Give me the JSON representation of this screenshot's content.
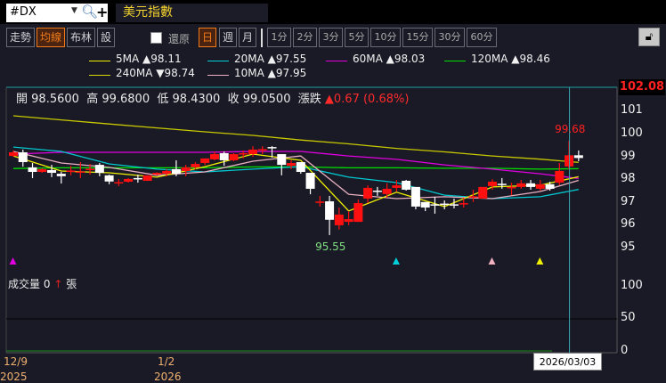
{
  "header": {
    "symbol": "#DX",
    "title": "美元指數"
  },
  "toolbar": {
    "modes": [
      {
        "label": "走勢",
        "active": false
      },
      {
        "label": "均線",
        "active": true
      },
      {
        "label": "布林",
        "active": false
      },
      {
        "label": "設",
        "active": false
      }
    ],
    "restore_label": "還原",
    "restore_checked": false,
    "periods": [
      {
        "label": "日",
        "active": true
      },
      {
        "label": "週",
        "active": false
      },
      {
        "label": "月",
        "active": false
      }
    ],
    "intervals": [
      "1分",
      "2分",
      "3分",
      "5分",
      "10分",
      "15分",
      "30分",
      "60分"
    ]
  },
  "legend": [
    {
      "name": "5MA",
      "dir": "▲",
      "value": "98.11",
      "color": "#f0f000"
    },
    {
      "name": "20MA",
      "dir": "▲",
      "value": "97.55",
      "color": "#00d0d8"
    },
    {
      "name": "60MA",
      "dir": "▲",
      "value": "98.03",
      "color": "#e000e0"
    },
    {
      "name": "120MA",
      "dir": "▲",
      "value": "98.46",
      "color": "#00e000"
    },
    {
      "name": "240MA",
      "dir": "▼",
      "value": "98.74",
      "color": "#d8d800"
    },
    {
      "name": "10MA",
      "dir": "▲",
      "value": "97.95",
      "color": "#f0b0c0"
    }
  ],
  "info": {
    "open_label": "開",
    "open": "98.5600",
    "high_label": "高",
    "high": "99.6800",
    "low_label": "低",
    "low": "98.4300",
    "close_label": "收",
    "close": "99.0500",
    "change_label": "漲跌",
    "change": "▲0.67 (0.68%)"
  },
  "volume": {
    "label": "成交量",
    "value": "0",
    "arrow": "↑",
    "unit": "張"
  },
  "selected_date": "2026/03/03",
  "current_price_label": "102.08",
  "chart_data": {
    "type": "candlestick",
    "price_axis": {
      "ticks": [
        "101",
        "100",
        "99",
        "98",
        "97",
        "96",
        "95"
      ]
    },
    "volume_axis": {
      "ticks": [
        "100",
        "50",
        "0"
      ]
    },
    "x_labels": [
      {
        "date": "12/9",
        "year": "2025",
        "index": 0
      },
      {
        "date": "1/2",
        "year": "2026",
        "index": 15
      }
    ],
    "annotations": [
      {
        "text": "99.68",
        "index": 58,
        "color": "#ff2020",
        "type": "high"
      },
      {
        "text": "95.55",
        "index": 33,
        "color": "#80e080",
        "type": "low"
      }
    ],
    "crosshair_index": 58,
    "up_color": "#ff1010",
    "down_color": "#ffffff",
    "ohlc": [
      [
        99.02,
        99.26,
        98.98,
        99.18
      ],
      [
        99.18,
        99.3,
        98.55,
        98.75
      ],
      [
        98.52,
        98.71,
        98.05,
        98.32
      ],
      [
        98.32,
        98.48,
        98.28,
        98.44
      ],
      [
        98.4,
        98.63,
        98.09,
        98.28
      ],
      [
        98.24,
        98.32,
        97.81,
        98.13
      ],
      [
        98.34,
        98.59,
        98.17,
        98.38
      ],
      [
        98.3,
        98.75,
        98.05,
        98.34
      ],
      [
        98.42,
        98.67,
        98.2,
        98.46
      ],
      [
        98.63,
        98.71,
        98.13,
        98.28
      ],
      [
        98.17,
        98.2,
        97.78,
        97.9
      ],
      [
        97.83,
        98.01,
        97.7,
        97.87
      ],
      [
        97.89,
        98.05,
        97.85,
        98.01
      ],
      [
        98.05,
        98.2,
        97.85,
        98.01
      ],
      [
        97.93,
        98.17,
        97.93,
        98.17
      ],
      [
        98.2,
        98.3,
        98.17,
        98.28
      ],
      [
        98.24,
        98.44,
        98.13,
        98.36
      ],
      [
        98.44,
        98.83,
        98.13,
        98.24
      ],
      [
        98.36,
        98.63,
        98.13,
        98.52
      ],
      [
        98.52,
        98.75,
        98.44,
        98.67
      ],
      [
        98.71,
        98.91,
        98.63,
        98.91
      ],
      [
        98.87,
        99.22,
        98.83,
        99.1
      ],
      [
        99.14,
        99.22,
        98.59,
        98.83
      ],
      [
        98.83,
        99.14,
        98.79,
        99.1
      ],
      [
        99.14,
        99.26,
        98.91,
        99.14
      ],
      [
        99.1,
        99.45,
        98.98,
        99.3
      ],
      [
        99.3,
        99.45,
        99.1,
        99.32
      ],
      [
        99.41,
        99.45,
        98.95,
        99.37
      ],
      [
        99.1,
        99.1,
        98.17,
        98.63
      ],
      [
        98.59,
        98.83,
        98.44,
        98.71
      ],
      [
        98.75,
        98.75,
        98.24,
        98.32
      ],
      [
        98.28,
        98.28,
        97.34,
        97.58
      ],
      [
        97.0,
        97.27,
        96.8,
        97.02
      ],
      [
        97.03,
        97.27,
        95.55,
        96.22
      ],
      [
        95.98,
        96.76,
        95.79,
        96.45
      ],
      [
        96.13,
        96.6,
        95.98,
        96.25
      ],
      [
        96.13,
        97.11,
        96.13,
        96.95
      ],
      [
        97.15,
        97.73,
        96.95,
        97.62
      ],
      [
        97.5,
        97.66,
        97.27,
        97.46
      ],
      [
        97.35,
        97.82,
        97.19,
        97.58
      ],
      [
        97.62,
        97.97,
        97.46,
        97.73
      ],
      [
        97.93,
        97.97,
        97.5,
        97.54
      ],
      [
        97.66,
        97.66,
        96.68,
        96.8
      ],
      [
        97.0,
        97.0,
        96.6,
        96.76
      ],
      [
        96.9,
        97.23,
        96.49,
        96.86
      ],
      [
        96.93,
        97.07,
        96.68,
        96.89
      ],
      [
        96.9,
        97.15,
        96.72,
        96.86
      ],
      [
        96.9,
        97.19,
        96.76,
        96.95
      ],
      [
        97.2,
        97.54,
        97.0,
        97.25
      ],
      [
        97.15,
        97.66,
        97.15,
        97.66
      ],
      [
        97.7,
        98.0,
        97.54,
        97.89
      ],
      [
        97.8,
        98.05,
        97.58,
        97.78
      ],
      [
        97.6,
        97.85,
        97.3,
        97.66
      ],
      [
        97.66,
        97.97,
        97.58,
        97.82
      ],
      [
        97.82,
        97.97,
        97.54,
        97.66
      ],
      [
        97.58,
        97.97,
        97.5,
        97.78
      ],
      [
        97.78,
        97.89,
        97.5,
        97.58
      ],
      [
        97.85,
        98.71,
        97.74,
        98.36
      ],
      [
        98.56,
        99.68,
        98.43,
        99.05
      ],
      [
        99.05,
        99.26,
        98.79,
        98.93
      ]
    ],
    "ma_sample_index": [
      0,
      5,
      10,
      15,
      20,
      25,
      30,
      35,
      40,
      45,
      50,
      55,
      59
    ],
    "ma": [
      {
        "name": "240MA",
        "color": "#c8c800",
        "values": [
          100.78,
          100.6,
          100.42,
          100.25,
          100.08,
          99.92,
          99.72,
          99.55,
          99.35,
          99.2,
          99.02,
          98.88,
          98.74
        ]
      },
      {
        "name": "120MA",
        "color": "#00e000",
        "values": [
          98.47,
          98.5,
          98.5,
          98.5,
          98.5,
          98.54,
          98.54,
          98.5,
          98.5,
          98.48,
          98.48,
          98.44,
          98.46
        ]
      },
      {
        "name": "60MA",
        "color": "#e000e0",
        "values": [
          99.1,
          99.18,
          99.18,
          99.18,
          99.18,
          99.22,
          99.22,
          99.02,
          98.87,
          98.63,
          98.44,
          98.24,
          98.03
        ]
      },
      {
        "name": "20MA",
        "color": "#00c8d0",
        "values": [
          99.41,
          99.22,
          98.67,
          98.44,
          98.32,
          98.44,
          98.55,
          98.09,
          97.85,
          97.3,
          97.15,
          97.23,
          97.55
        ]
      },
      {
        "name": "10MA",
        "color": "#e8b0c0",
        "values": [
          99.22,
          98.71,
          98.52,
          98.17,
          98.32,
          98.79,
          99.02,
          97.34,
          97.15,
          97.23,
          97.15,
          97.46,
          97.95
        ]
      },
      {
        "name": "5MA",
        "color": "#f0f000",
        "values": [
          99.02,
          98.36,
          98.28,
          98.09,
          98.55,
          99.1,
          98.83,
          96.61,
          97.43,
          96.8,
          97.66,
          97.74,
          98.11
        ]
      }
    ],
    "signal_markers": [
      {
        "index": 0,
        "color": "#e000e0"
      },
      {
        "index": 40,
        "color": "#00d0d8"
      },
      {
        "index": 50,
        "color": "#f0b0c0"
      },
      {
        "index": 55,
        "color": "#f0f000"
      }
    ]
  }
}
